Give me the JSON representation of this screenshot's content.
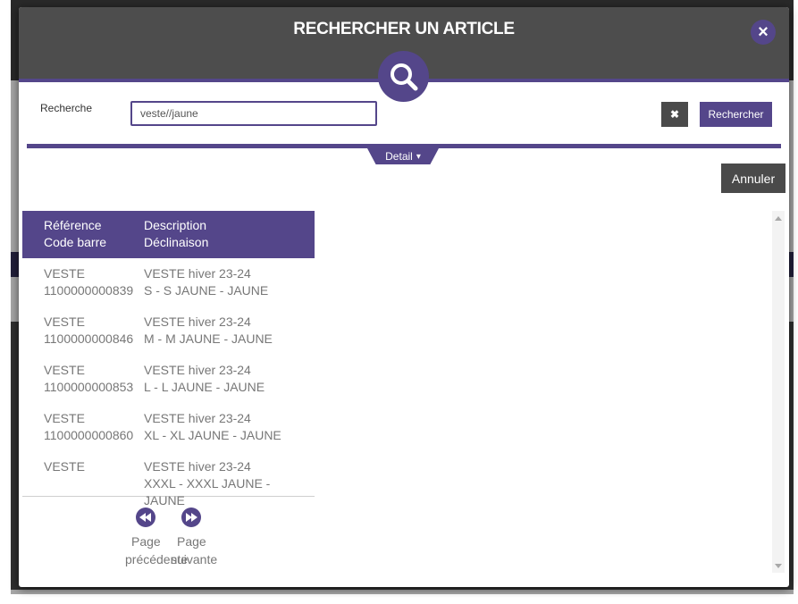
{
  "modal": {
    "title": "RECHERCHER UN ARTICLE",
    "close_icon": "×"
  },
  "search": {
    "label": "Recherche",
    "value": "veste//jaune",
    "clear_icon": "✖",
    "submit_label": "Rechercher"
  },
  "detail_tab": {
    "label": "Detail",
    "caret": "▾"
  },
  "cancel_label": "Annuler",
  "table": {
    "headers": {
      "col1_line1": "Référence",
      "col1_line2": "Code barre",
      "col2_line1": "Description",
      "col2_line2": "Déclinaison"
    },
    "rows": [
      {
        "reference": "VESTE",
        "barcode": "1100000000839",
        "description": "VESTE hiver 23-24",
        "variant": "S - S JAUNE - JAUNE"
      },
      {
        "reference": "VESTE",
        "barcode": "1100000000846",
        "description": "VESTE hiver 23-24",
        "variant": "M - M JAUNE - JAUNE"
      },
      {
        "reference": "VESTE",
        "barcode": "1100000000853",
        "description": "VESTE hiver 23-24",
        "variant": "L - L JAUNE - JAUNE"
      },
      {
        "reference": "VESTE",
        "barcode": "1100000000860",
        "description": "VESTE hiver 23-24",
        "variant": "XL - XL JAUNE - JAUNE"
      },
      {
        "reference": "VESTE",
        "barcode": "",
        "description": "VESTE hiver 23-24",
        "variant": "XXXL - XXXL JAUNE - JAUNE"
      }
    ]
  },
  "pager": {
    "prev_line1": "Page",
    "prev_line2": "précédente",
    "next_line1": "Page",
    "next_line2": "suivante"
  },
  "colors": {
    "accent": "#54468a",
    "header_bg": "#4d4d4d",
    "dark_button": "#4a4a4a"
  }
}
